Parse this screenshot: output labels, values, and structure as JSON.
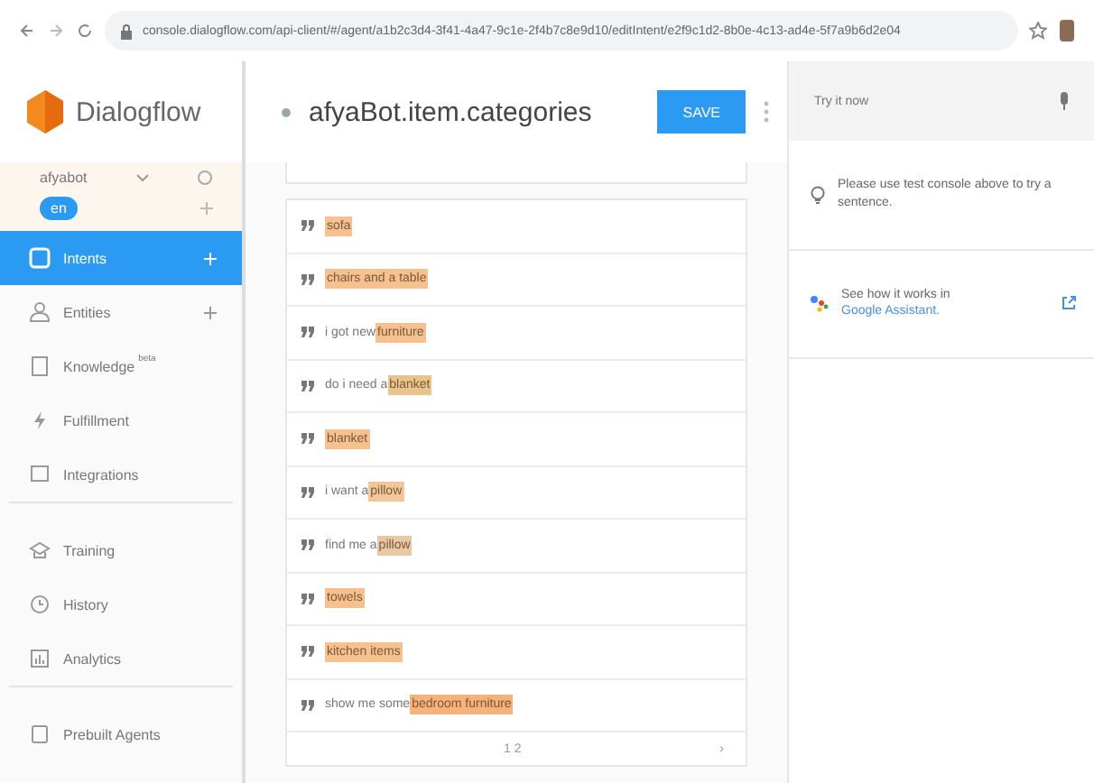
{
  "browser": {
    "url": "console.dialogflow.com/api-client/#/agent/a1b2c3d4-3f41-4a47-9c1e-2f4b7c8e9d10/editIntent/e2f9c1d2-8b0e-4c13-ad4e-5f7a9b6d2e04"
  },
  "brand": {
    "name": "Dialogflow"
  },
  "agent": {
    "name": "afyabot",
    "language": "en"
  },
  "sidebar": {
    "items": [
      {
        "label": "Intents",
        "selected": true,
        "add": true
      },
      {
        "label": "Entities",
        "selected": false,
        "add": true
      },
      {
        "label": "Knowledge",
        "badge": "beta",
        "selected": false,
        "add": false
      },
      {
        "label": "Fulfillment",
        "selected": false,
        "add": false
      },
      {
        "label": "Integrations",
        "selected": false,
        "add": false,
        "divider_after": true
      },
      {
        "label": "Training",
        "selected": false,
        "add": false
      },
      {
        "label": "History",
        "selected": false,
        "add": false
      },
      {
        "label": "Analytics",
        "selected": false,
        "add": false,
        "divider_after": true
      },
      {
        "label": "Prebuilt Agents",
        "selected": false,
        "add": false
      }
    ]
  },
  "intent": {
    "title": "afyaBot.item.categories",
    "save": "SAVE"
  },
  "phrases": [
    {
      "entity": "sofa",
      "color": "#f6c08f"
    },
    {
      "entity": "chairs and a table",
      "color": "#f6c08f"
    },
    {
      "prefix": "i got new ",
      "entity": "furniture",
      "color": "#f6c08f"
    },
    {
      "prefix": "do i need a ",
      "entity": "blanket",
      "color": "#e9c48a"
    },
    {
      "entity": "blanket",
      "color": "#f6c08f"
    },
    {
      "prefix": "i want a ",
      "entity": "pillow",
      "color": "#f1c79b"
    },
    {
      "prefix": "find me a ",
      "entity": "pillow",
      "color": "#e9c9a5"
    },
    {
      "entity": "towels",
      "color": "#f6c08f"
    },
    {
      "entity": "kitchen items",
      "color": "#f6c08f"
    },
    {
      "prefix": "show me some ",
      "entity": "bedroom furniture",
      "color": "#f6b27a"
    }
  ],
  "pagination": {
    "pages": "1 2",
    "next": "›"
  },
  "try_panel": {
    "placeholder": "Try it now",
    "hint": "Please use test console above to try a sentence.",
    "assistant_text": "See how it works in ",
    "assistant_link": "Google Assistant."
  }
}
